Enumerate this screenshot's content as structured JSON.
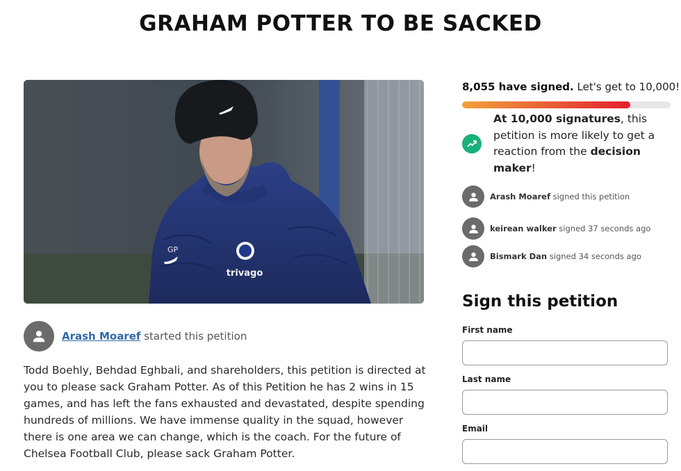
{
  "page": {
    "title": "GRAHAM POTTER TO BE SACKED"
  },
  "hero_image": {
    "beanie_logo": "nike-swoosh-icon",
    "jacket_initials": "GP",
    "jacket_sponsor": "trivago"
  },
  "starter": {
    "name": "Arash Moaref",
    "action": "started this petition"
  },
  "description": "Todd Boehly, Behdad Eghbali, and shareholders, this petition is directed at you to please sack Graham Potter. As of this Petition he has 2 wins in 15 games, and has left the fans exhausted and devastated, despite spending hundreds of millions. We have immense quality in the squad, however there is one area we can change, which is the coach. For the future of Chelsea Football Club, please sack Graham Potter.",
  "progress": {
    "count_text": "8,055 have signed.",
    "goal_text": "Let's get to 10,000!",
    "signed": 8055,
    "goal": 10000,
    "fraction": 0.8055,
    "bar_color_start": "#f0a13a",
    "bar_color_end": "#e4202f"
  },
  "goal_note": {
    "icon": "trending-up-icon",
    "part1": "At 10,000 signatures",
    "part2": ", this petition is more likely to get a reaction from the ",
    "part3": "decision maker",
    "part4": "!",
    "icon_color": "#19b07a"
  },
  "recent_signers": [
    {
      "name": "Arash Moaref",
      "action": "signed this petition"
    },
    {
      "name": "keirean walker",
      "action": "signed 37 seconds ago"
    },
    {
      "name": "Bismark Dan",
      "action": "signed 34 seconds ago"
    }
  ],
  "form": {
    "title": "Sign this petition",
    "first_name_label": "First name",
    "first_name_value": "",
    "last_name_label": "Last name",
    "last_name_value": "",
    "email_label": "Email",
    "email_value": ""
  }
}
